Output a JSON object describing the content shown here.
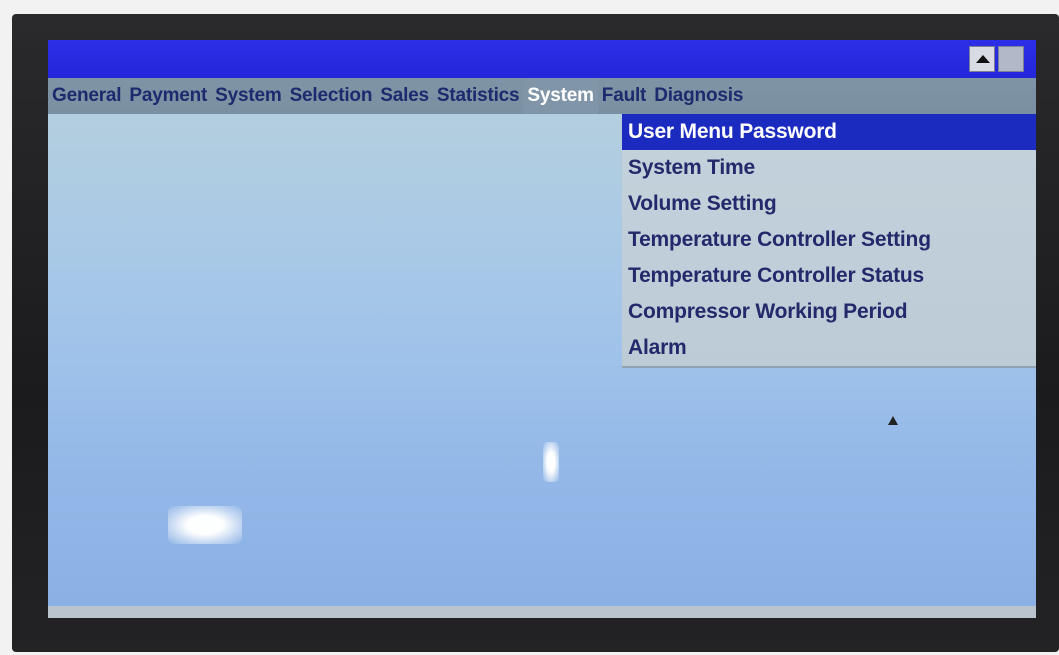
{
  "menu_bar": {
    "items": [
      {
        "label": "General",
        "active": false
      },
      {
        "label": "Payment",
        "active": false
      },
      {
        "label": "System",
        "active": false
      },
      {
        "label": "Selection",
        "active": false
      },
      {
        "label": "Sales",
        "active": false
      },
      {
        "label": "Statistics",
        "active": false
      },
      {
        "label": "System",
        "active": true
      },
      {
        "label": "Fault",
        "active": false
      },
      {
        "label": "Diagnosis",
        "active": false
      }
    ]
  },
  "dropdown": {
    "items": [
      {
        "label": "User Menu Password",
        "selected": true
      },
      {
        "label": "System Time",
        "selected": false
      },
      {
        "label": "Volume Setting",
        "selected": false
      },
      {
        "label": "Temperature Controller Setting",
        "selected": false
      },
      {
        "label": "Temperature Controller Status",
        "selected": false
      },
      {
        "label": "Compressor Working Period",
        "selected": false
      },
      {
        "label": "Alarm",
        "selected": false
      }
    ]
  },
  "window_buttons": {
    "up_icon": "triangle-up-icon",
    "maximize_icon": "square-icon"
  },
  "colors": {
    "title_bar": "#2c2fe6",
    "menu_bar": "#7f95a6",
    "menu_text": "#1d2a6e",
    "selection": "#1c2bbf",
    "dropdown_bg": "#c4d2dc"
  }
}
